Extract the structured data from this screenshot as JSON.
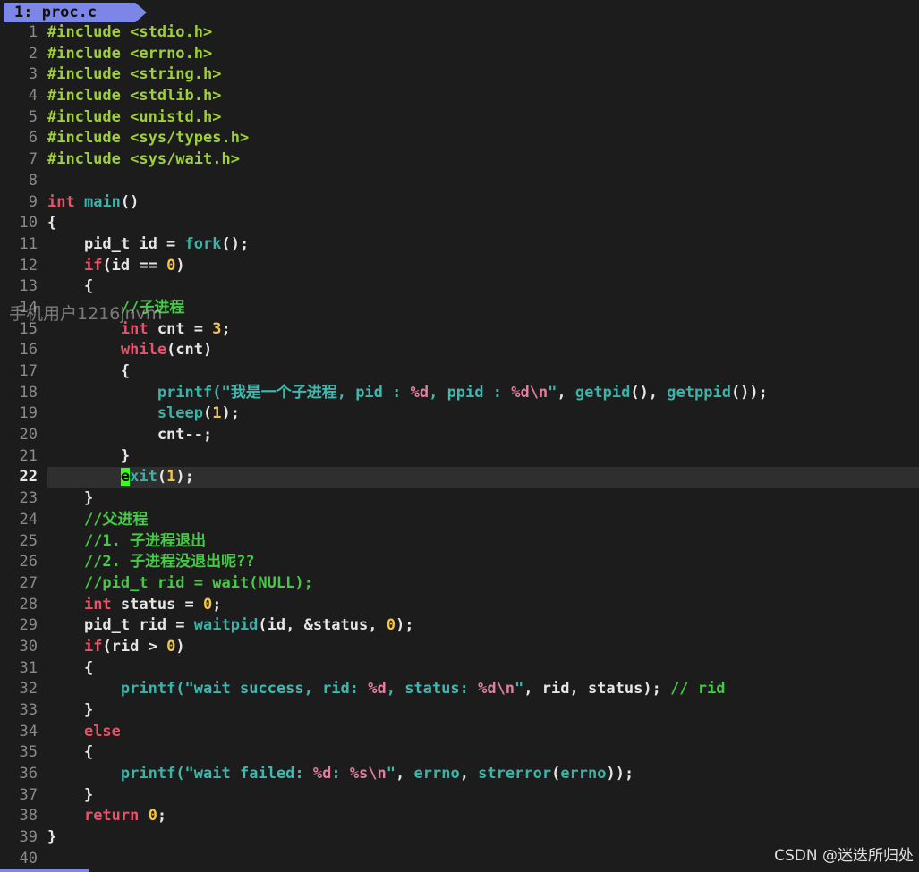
{
  "tab": {
    "label": "1: proc.c"
  },
  "lines": [
    {
      "n": "1",
      "parts": [
        {
          "t": "#include ",
          "c": "pp"
        },
        {
          "t": "<stdio.h>",
          "c": "pp"
        }
      ]
    },
    {
      "n": "2",
      "parts": [
        {
          "t": "#include ",
          "c": "pp"
        },
        {
          "t": "<errno.h>",
          "c": "pp"
        }
      ]
    },
    {
      "n": "3",
      "parts": [
        {
          "t": "#include ",
          "c": "pp"
        },
        {
          "t": "<string.h>",
          "c": "pp"
        }
      ]
    },
    {
      "n": "4",
      "parts": [
        {
          "t": "#include ",
          "c": "pp"
        },
        {
          "t": "<stdlib.h>",
          "c": "pp"
        }
      ]
    },
    {
      "n": "5",
      "parts": [
        {
          "t": "#include ",
          "c": "pp"
        },
        {
          "t": "<unistd.h>",
          "c": "pp"
        }
      ]
    },
    {
      "n": "6",
      "parts": [
        {
          "t": "#include ",
          "c": "pp"
        },
        {
          "t": "<sys/types.h>",
          "c": "pp"
        }
      ]
    },
    {
      "n": "7",
      "parts": [
        {
          "t": "#include ",
          "c": "pp"
        },
        {
          "t": "<sys/wait.h>",
          "c": "pp"
        }
      ]
    },
    {
      "n": "8",
      "parts": []
    },
    {
      "n": "9",
      "parts": [
        {
          "t": "int",
          "c": "kw"
        },
        {
          "t": " "
        },
        {
          "t": "main",
          "c": "fn"
        },
        {
          "t": "()"
        }
      ]
    },
    {
      "n": "10",
      "parts": [
        {
          "t": "{"
        }
      ]
    },
    {
      "n": "11",
      "parts": [
        {
          "t": "    pid_t id = "
        },
        {
          "t": "fork",
          "c": "fn"
        },
        {
          "t": "();"
        }
      ]
    },
    {
      "n": "12",
      "parts": [
        {
          "t": "    "
        },
        {
          "t": "if",
          "c": "kw"
        },
        {
          "t": "(id == "
        },
        {
          "t": "0",
          "c": "num"
        },
        {
          "t": ")"
        }
      ]
    },
    {
      "n": "13",
      "parts": [
        {
          "t": "    {"
        }
      ]
    },
    {
      "n": "14",
      "parts": [
        {
          "t": "        "
        },
        {
          "t": "//子进程",
          "c": "cm"
        }
      ]
    },
    {
      "n": "15",
      "parts": [
        {
          "t": "        "
        },
        {
          "t": "int",
          "c": "kw"
        },
        {
          "t": " cnt = "
        },
        {
          "t": "3",
          "c": "num"
        },
        {
          "t": ";"
        }
      ]
    },
    {
      "n": "16",
      "parts": [
        {
          "t": "        "
        },
        {
          "t": "while",
          "c": "kw"
        },
        {
          "t": "(cnt)"
        }
      ]
    },
    {
      "n": "17",
      "parts": [
        {
          "t": "        {"
        }
      ]
    },
    {
      "n": "18",
      "parts": [
        {
          "t": "            "
        },
        {
          "t": "printf",
          "c": "fn"
        },
        {
          "t": "(\"我是一个子进程, pid : ",
          "c": "str"
        },
        {
          "t": "%d",
          "c": "fmt"
        },
        {
          "t": ", ppid : ",
          "c": "str"
        },
        {
          "t": "%d\\n",
          "c": "fmt"
        },
        {
          "t": "\"",
          "c": "str"
        },
        {
          "t": ", "
        },
        {
          "t": "getpid",
          "c": "fn"
        },
        {
          "t": "(), "
        },
        {
          "t": "getppid",
          "c": "fn"
        },
        {
          "t": "());"
        }
      ]
    },
    {
      "n": "19",
      "parts": [
        {
          "t": "            "
        },
        {
          "t": "sleep",
          "c": "fn"
        },
        {
          "t": "("
        },
        {
          "t": "1",
          "c": "num"
        },
        {
          "t": ");"
        }
      ]
    },
    {
      "n": "20",
      "parts": [
        {
          "t": "            cnt--;"
        }
      ]
    },
    {
      "n": "21",
      "parts": [
        {
          "t": "        }"
        }
      ]
    },
    {
      "n": "22",
      "current": true,
      "parts": [
        {
          "t": "        "
        },
        {
          "t": "e",
          "c": "cursor"
        },
        {
          "t": "xit",
          "c": "fn"
        },
        {
          "t": "("
        },
        {
          "t": "1",
          "c": "num"
        },
        {
          "t": ");"
        }
      ]
    },
    {
      "n": "23",
      "parts": [
        {
          "t": "    }"
        }
      ]
    },
    {
      "n": "24",
      "parts": [
        {
          "t": "    "
        },
        {
          "t": "//父进程",
          "c": "cm"
        }
      ]
    },
    {
      "n": "25",
      "parts": [
        {
          "t": "    "
        },
        {
          "t": "//1. 子进程退出",
          "c": "cm"
        }
      ]
    },
    {
      "n": "26",
      "parts": [
        {
          "t": "    "
        },
        {
          "t": "//2. 子进程没退出呢??",
          "c": "cm"
        }
      ]
    },
    {
      "n": "27",
      "parts": [
        {
          "t": "    "
        },
        {
          "t": "//pid_t rid = wait(NULL);",
          "c": "cm"
        }
      ]
    },
    {
      "n": "28",
      "parts": [
        {
          "t": "    "
        },
        {
          "t": "int",
          "c": "kw"
        },
        {
          "t": " status = "
        },
        {
          "t": "0",
          "c": "num"
        },
        {
          "t": ";"
        }
      ]
    },
    {
      "n": "29",
      "parts": [
        {
          "t": "    pid_t rid = "
        },
        {
          "t": "waitpid",
          "c": "fn"
        },
        {
          "t": "(id, &status, "
        },
        {
          "t": "0",
          "c": "num"
        },
        {
          "t": ");"
        }
      ]
    },
    {
      "n": "30",
      "parts": [
        {
          "t": "    "
        },
        {
          "t": "if",
          "c": "kw"
        },
        {
          "t": "(rid > "
        },
        {
          "t": "0",
          "c": "num"
        },
        {
          "t": ")"
        }
      ]
    },
    {
      "n": "31",
      "parts": [
        {
          "t": "    {"
        }
      ]
    },
    {
      "n": "32",
      "parts": [
        {
          "t": "        "
        },
        {
          "t": "printf",
          "c": "fn"
        },
        {
          "t": "(\"wait success, rid: ",
          "c": "str"
        },
        {
          "t": "%d",
          "c": "fmt"
        },
        {
          "t": ", status: ",
          "c": "str"
        },
        {
          "t": "%d\\n",
          "c": "fmt"
        },
        {
          "t": "\"",
          "c": "str"
        },
        {
          "t": ", rid, status); "
        },
        {
          "t": "// rid",
          "c": "cm"
        }
      ]
    },
    {
      "n": "33",
      "parts": [
        {
          "t": "    }"
        }
      ]
    },
    {
      "n": "34",
      "parts": [
        {
          "t": "    "
        },
        {
          "t": "else",
          "c": "kw"
        }
      ]
    },
    {
      "n": "35",
      "parts": [
        {
          "t": "    {"
        }
      ]
    },
    {
      "n": "36",
      "parts": [
        {
          "t": "        "
        },
        {
          "t": "printf",
          "c": "fn"
        },
        {
          "t": "(\"wait failed: ",
          "c": "str"
        },
        {
          "t": "%d",
          "c": "fmt"
        },
        {
          "t": ": ",
          "c": "str"
        },
        {
          "t": "%s\\n",
          "c": "fmt"
        },
        {
          "t": "\"",
          "c": "str"
        },
        {
          "t": ", "
        },
        {
          "t": "errno",
          "c": "fn"
        },
        {
          "t": ", "
        },
        {
          "t": "strerror",
          "c": "fn"
        },
        {
          "t": "("
        },
        {
          "t": "errno",
          "c": "fn"
        },
        {
          "t": "));"
        }
      ]
    },
    {
      "n": "37",
      "parts": [
        {
          "t": "    }"
        }
      ]
    },
    {
      "n": "38",
      "parts": [
        {
          "t": "    "
        },
        {
          "t": "return",
          "c": "kw"
        },
        {
          "t": " "
        },
        {
          "t": "0",
          "c": "num"
        },
        {
          "t": ";"
        }
      ]
    },
    {
      "n": "39",
      "parts": [
        {
          "t": "}"
        }
      ]
    },
    {
      "n": "40",
      "parts": []
    }
  ],
  "watermarks": {
    "overlay": "手机用户1216jnvm",
    "footer": "CSDN @迷迭所归处"
  },
  "colors": {
    "background": "#1c1c1c",
    "tab": "#7b86e6",
    "preprocessor": "#9fcf3a",
    "keyword": "#e8536a",
    "function": "#3ab3a8",
    "number": "#f5c542",
    "comment": "#46c946",
    "cursor": "#39ff14"
  }
}
